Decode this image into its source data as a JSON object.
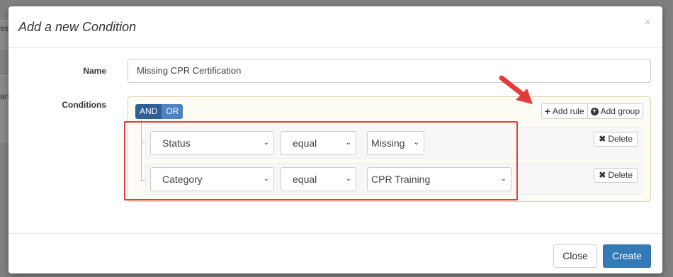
{
  "background": {
    "fragments": [
      "ss",
      "an"
    ]
  },
  "modal": {
    "title": "Add a new Condition",
    "close_glyph": "×"
  },
  "form": {
    "name_label": "Name",
    "name_value": "Missing CPR Certification",
    "conditions_label": "Conditions"
  },
  "builder": {
    "and_label": "AND",
    "or_label": "OR",
    "add_rule_label": "Add rule",
    "add_group_label": "Add group",
    "rules": [
      {
        "field": "Status",
        "operator": "equal",
        "value": "Missing",
        "delete_label": "Delete"
      },
      {
        "field": "Category",
        "operator": "equal",
        "value": "CPR Training",
        "delete_label": "Delete"
      }
    ]
  },
  "footer": {
    "close_label": "Close",
    "create_label": "Create"
  },
  "colors": {
    "highlight": "#e53a3a",
    "primary": "#337ab7",
    "and_active": "#2f5f96"
  },
  "icons": {
    "close": "close-icon",
    "add_rule": "plus-icon",
    "add_group": "plus-circle-icon",
    "delete": "x-icon",
    "select_arrow": "chevron-down-icon",
    "annotation_arrow": "red-arrow-icon"
  }
}
